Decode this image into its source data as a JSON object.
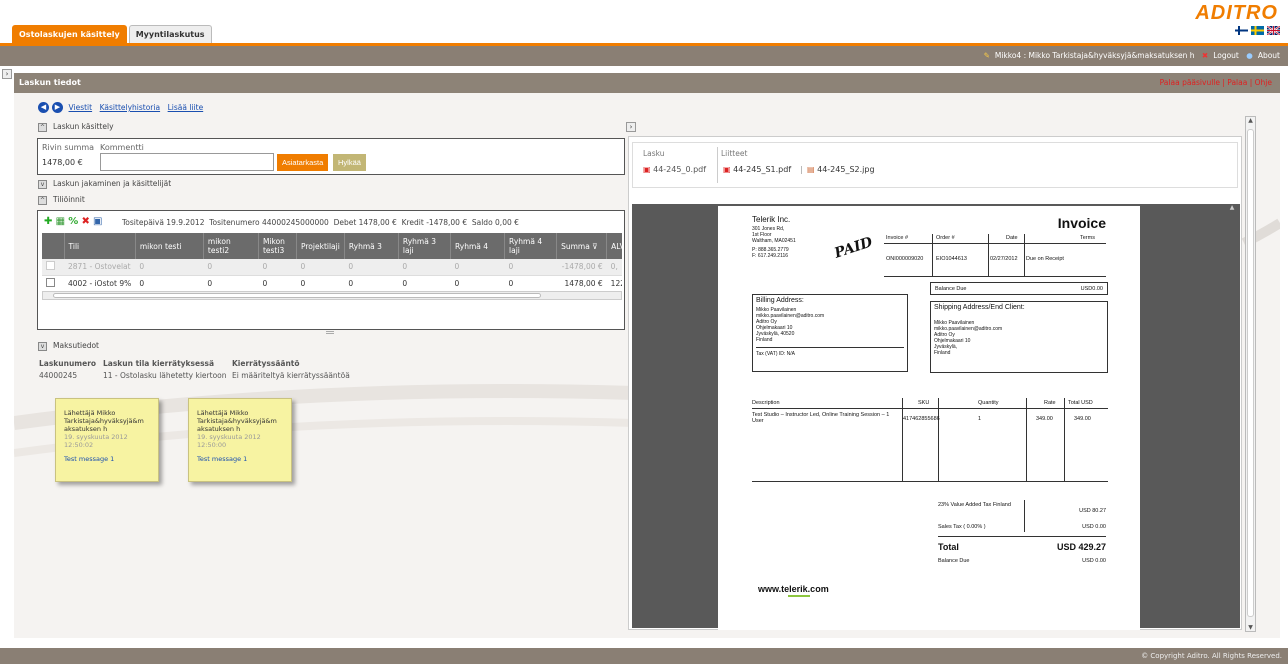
{
  "brand": {
    "logo": "ADITRO"
  },
  "tabs": [
    {
      "label": "Ostolaskujen käsittely"
    },
    {
      "label": "Myyntilaskutus"
    }
  ],
  "userbar": {
    "user": "Mikko4 : Mikko Tarkistaja&hyväksyjä&maksatuksen h",
    "logout": "Logout",
    "about": "About"
  },
  "section": {
    "title": "Laskun tiedot",
    "links": "Palaa pääsivulle | Palaa | Ohje"
  },
  "nav_links": [
    "Viestit",
    "Käsittelyhistoria",
    "Lisää liite"
  ],
  "handling": {
    "title": "Laskun käsittely",
    "row_sum_label": "Rivin summa",
    "comment_label": "Kommentti",
    "row_sum_value": "1478,00 €",
    "comment_value": "",
    "btn_check": "Asiatarkasta",
    "btn_reject": "Hylkää"
  },
  "split_title": "Laskun jakaminen ja käsittelijät",
  "postings": {
    "title": "Tiliöinnit",
    "summary": "Tositepäivä 19.9.2012  Tositenumero 44000245000000  Debet 1478,00 €  Kredit -1478,00 €  Saldo 0,00 €",
    "columns": [
      "Tili",
      "mikon testi",
      "mikon testi2",
      "Mikon testi3",
      "Projektilaji",
      "Ryhmä 3",
      "Ryhmä 3 laji",
      "Ryhmä 4",
      "Ryhmä 4 laji",
      "Summa",
      "ALV"
    ],
    "rows": [
      [
        "2871 - Ostovelat",
        "0",
        "0",
        "0",
        "0",
        "0",
        "0",
        "0",
        "0",
        "-1478,00 €",
        "0,"
      ],
      [
        "4002 - iOstot 9%",
        "0",
        "0",
        "0",
        "0",
        "0",
        "0",
        "0",
        "0",
        "1478,00 €",
        "122,"
      ]
    ]
  },
  "payment": {
    "title": "Maksutiedot",
    "labels": [
      "Laskunumero",
      "Laskun tila kierrätyksessä",
      "Kierrätyssääntö"
    ],
    "values": [
      "44000245",
      "11 - Ostolasku lähetetty kiertoon",
      "Ei määriteltyä kierrätyssääntöä"
    ]
  },
  "notes": [
    {
      "from": "Lähettäjä Mikko Tarkistaja&hyväksyjä&m aksatuksen h",
      "date": "19. syyskuuta 2012",
      "time": "12:50:02",
      "msg": "Test message 1"
    },
    {
      "from": "Lähettäjä Mikko Tarkistaja&hyväksyjä&m aksatuksen h",
      "date": "19. syyskuuta 2012",
      "time": "12:50:00",
      "msg": "Test message 1"
    }
  ],
  "attachments": {
    "invoice_label": "Lasku",
    "attachments_label": "Liitteet",
    "invoice_file": "44-245_0.pdf",
    "files": [
      "44-245_S1.pdf",
      "44-245_S2.jpg"
    ]
  },
  "invoice": {
    "company": "Telerik Inc.",
    "address": [
      "301 Jones Rd,",
      "1st Floor",
      "Waltham, MA02451"
    ],
    "phone": "P: 888.365.2779",
    "fax": "F: 617.249.2116",
    "title": "Invoice",
    "stamp": "PAID",
    "head_cols": [
      "Invoice #",
      "Order #",
      "Date",
      "Terms"
    ],
    "head_vals": [
      "ONI000009020",
      "EIO1044613",
      "02/27/2012",
      "Due on Receipt"
    ],
    "balance_label": "Balance Due",
    "balance_value": "USD0.00",
    "billing_title": "Billing Address:",
    "billing": [
      "Mikko Paavilainen",
      "mikko.paavilainen@aditro.com",
      "Aditro Oy",
      "Ohjelmakaari 10",
      "Jyväskylä, 40520",
      "Finland"
    ],
    "tax": "Tax (VAT) ID: N/A",
    "shipping_title": "Shipping Address/End Client:",
    "shipping": [
      "Mikko Paavilainen",
      "mikko.paavilainen@aditro.com",
      "Aditro Oy",
      "Ohjelmakaari 10",
      "Jyväskylä,",
      "Finland"
    ],
    "line_cols": [
      "Description",
      "SKU",
      "Quantity",
      "Rate",
      "Total USD"
    ],
    "line_desc": "Test Studio – Instructor Led, Online Training Session – 1 User",
    "line_vals": [
      "417462855686",
      "1",
      "349.00",
      "349.00"
    ],
    "vat_label": "23% Value Added Tax Finland",
    "vat_value": "USD 80.27",
    "sales_tax_label": "Sales Tax ( 0.00% )",
    "sales_tax_value": "USD 0.00",
    "total_label": "Total",
    "total_value": "USD 429.27",
    "balance2_label": "Balance Due",
    "balance2_value": "USD 0.00",
    "website": "www.telerik.com"
  },
  "footer": "© Copyright Aditro. All Rights Reserved."
}
